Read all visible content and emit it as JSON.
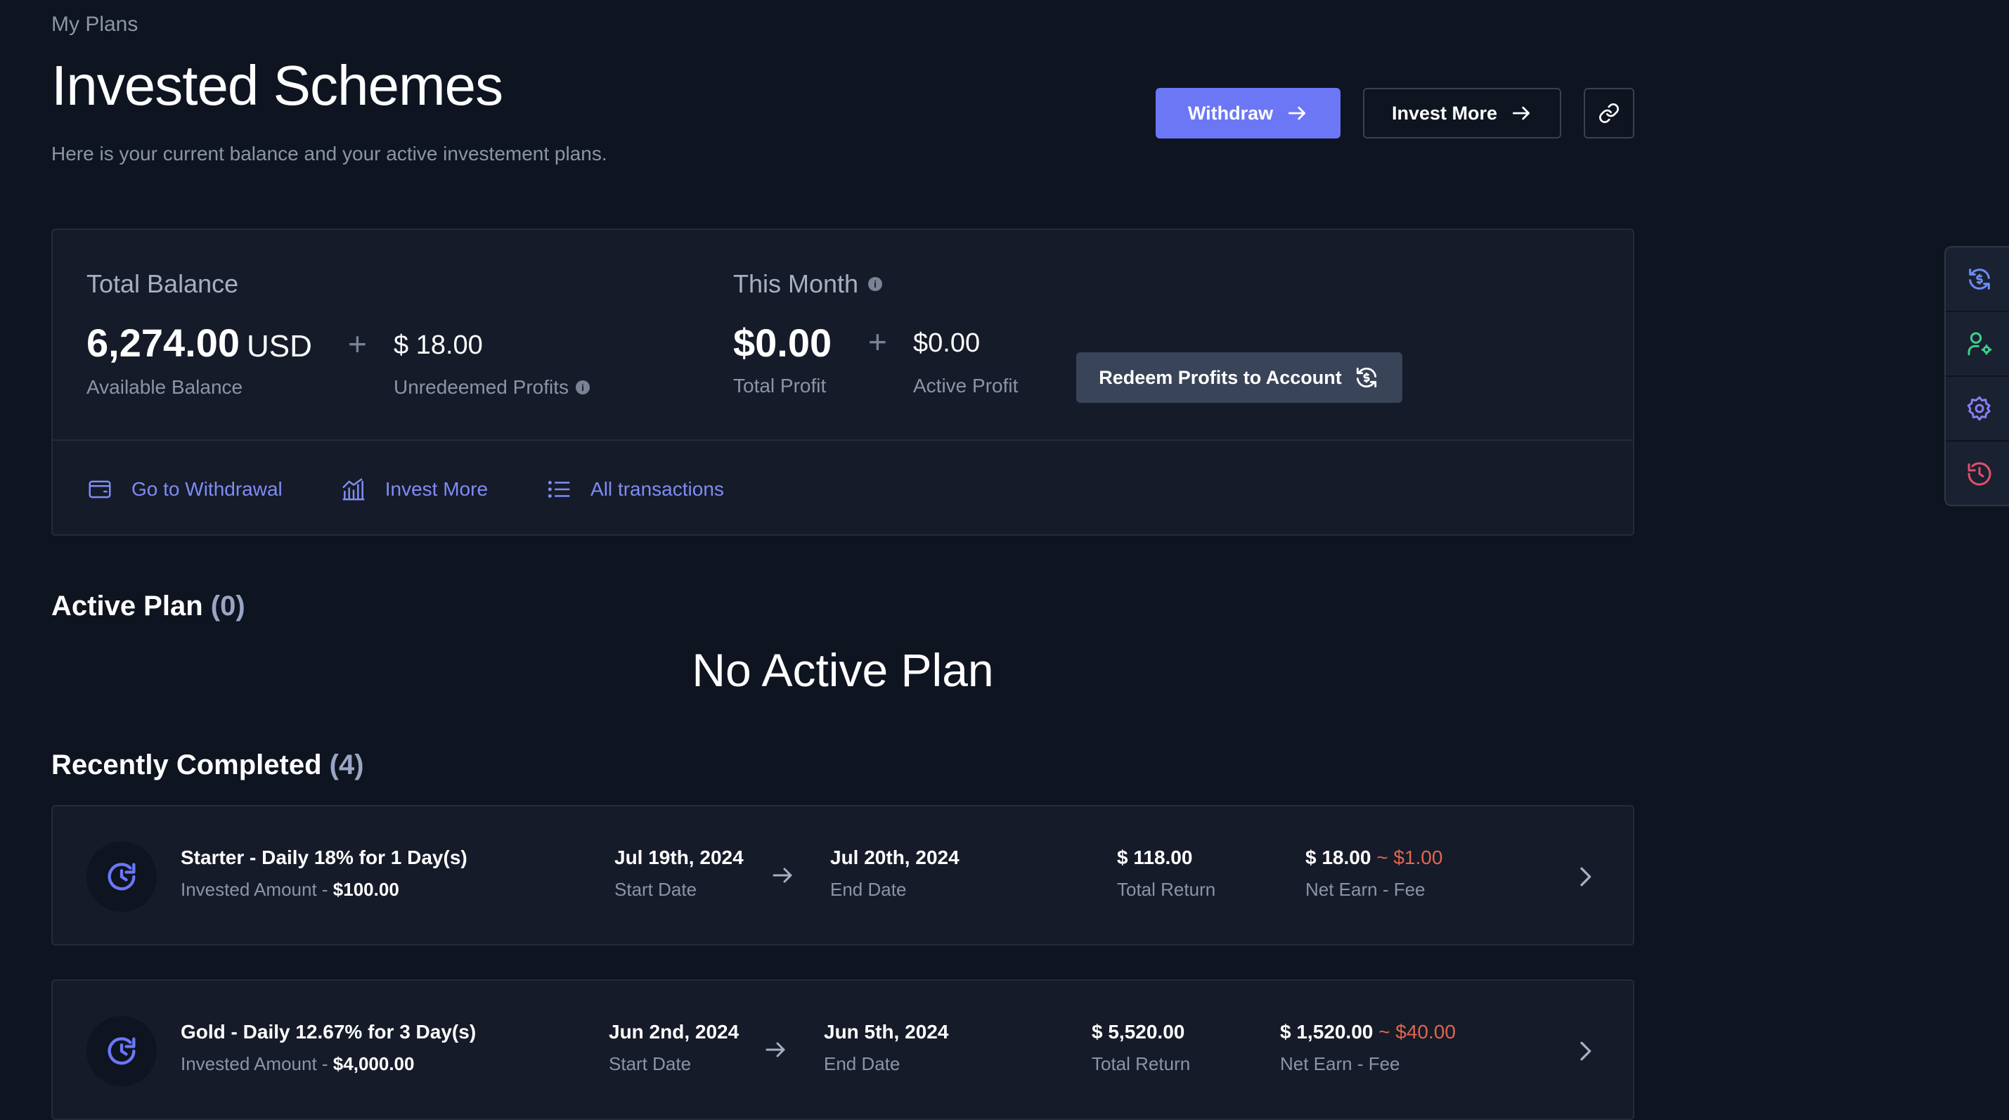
{
  "header": {
    "breadcrumb": "My Plans",
    "title": "Invested Schemes",
    "subtitle": "Here is your current balance and your active investement plans.",
    "withdraw_label": "Withdraw",
    "invest_more_label": "Invest More",
    "link_icon": "link-icon"
  },
  "balance": {
    "total_balance_label": "Total Balance",
    "available_value": "6,274.00",
    "available_unit": "USD",
    "available_label": "Available Balance",
    "unredeemed_value": "$ 18.00",
    "unredeemed_label": "Unredeemed Profits",
    "this_month_label": "This Month",
    "total_profit_value": "$0.00",
    "total_profit_label": "Total Profit",
    "active_profit_value": "$0.00",
    "active_profit_label": "Active Profit",
    "redeem_label": "Redeem Profits to Account",
    "plus": "+",
    "links": [
      {
        "label": "Go to Withdrawal",
        "icon": "wallet-icon"
      },
      {
        "label": "Invest More",
        "icon": "chart-bars-icon"
      },
      {
        "label": "All transactions",
        "icon": "list-icon"
      }
    ]
  },
  "active_plan": {
    "heading": "Active Plan",
    "count": "(0)",
    "empty_text": "No Active Plan"
  },
  "completed": {
    "heading": "Recently Completed",
    "count": "(4)",
    "invested_prefix": "Invested Amount - ",
    "start_label": "Start Date",
    "end_label": "End Date",
    "total_return_label": "Total Return",
    "net_label": "Net Earn - Fee",
    "fee_sep": "~",
    "items": [
      {
        "name": "Starter - Daily 18% for 1 Day(s)",
        "invested": "$100.00",
        "start_date": "Jul 19th, 2024",
        "end_date": "Jul 20th, 2024",
        "total_return": "$ 118.00",
        "net_earn": "$ 18.00",
        "fee": "$1.00"
      },
      {
        "name": "Gold - Daily 12.67% for 3 Day(s)",
        "invested": "$4,000.00",
        "start_date": "Jun 2nd, 2024",
        "end_date": "Jun 5th, 2024",
        "total_return": "$ 5,520.00",
        "net_earn": "$ 1,520.00",
        "fee": "$40.00"
      }
    ]
  },
  "side_panel": {
    "items": [
      {
        "icon": "currency-exchange-icon",
        "color": "#6b8cf5"
      },
      {
        "icon": "user-settings-icon",
        "color": "#3ecf8e"
      },
      {
        "icon": "gear-icon",
        "color": "#8b7cf6"
      },
      {
        "icon": "history-icon",
        "color": "#e0506e"
      }
    ]
  },
  "colors": {
    "background": "#0e1420",
    "card": "#151b28",
    "accent": "#6b77f5",
    "link": "#7f8cf5",
    "fee": "#e2654f"
  }
}
